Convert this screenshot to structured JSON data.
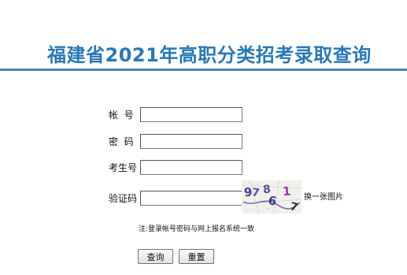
{
  "page": {
    "title": "福建省2021年高职分类招考录取查询"
  },
  "form": {
    "account_label": "帐  号",
    "account_value": "",
    "password_label": "密  码",
    "password_value": "",
    "exam_no_label": "考生号",
    "exam_no_value": "",
    "captcha_label": "验证码",
    "captcha_value": "",
    "captcha_image_text": "97861 7",
    "refresh_captcha_label": "换一张图片",
    "hint": "注:登录帐号密码与网上报名系统一致",
    "query_button": "查询",
    "reset_button": "重置"
  },
  "colors": {
    "title": "#2a78b5",
    "rule": "#3d86c0"
  }
}
